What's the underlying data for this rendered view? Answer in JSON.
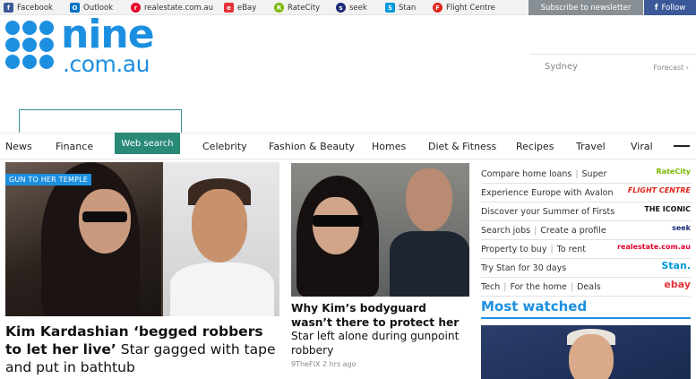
{
  "bookmarks": [
    {
      "label": "Facebook",
      "icon": "facebook-icon",
      "color": "#3b5998",
      "glyph": "f"
    },
    {
      "label": "Outlook",
      "icon": "outlook-icon",
      "color": "#0072c6",
      "glyph": "O"
    },
    {
      "label": "realestate.com.au",
      "icon": "realestate-icon",
      "color": "#e4002b",
      "glyph": "r"
    },
    {
      "label": "eBay",
      "icon": "ebay-icon",
      "color": "#e53238",
      "glyph": "e"
    },
    {
      "label": "RateCity",
      "icon": "ratecity-icon",
      "color": "#7ab800",
      "glyph": "R"
    },
    {
      "label": "seek",
      "icon": "seek-icon",
      "color": "#1c2a76",
      "glyph": "s"
    },
    {
      "label": "Stan",
      "icon": "stan-icon",
      "color": "#0099dd",
      "glyph": "S"
    },
    {
      "label": "Flight Centre",
      "icon": "flight-centre-icon",
      "color": "#e2231a",
      "glyph": "F"
    }
  ],
  "header": {
    "subscribe_label": "Subscribe to newsletter",
    "follow_label": "Follow",
    "logo_nine": "nine",
    "logo_domain": ".com.au",
    "city": "Sydney",
    "forecast_label": "Forecast ›"
  },
  "search": {
    "placeholder": ""
  },
  "nav": {
    "items": [
      "News",
      "Finance",
      "Web search",
      "Celebrity",
      "Fashion & Beauty",
      "Homes",
      "Diet & Fitness",
      "Recipes",
      "Travel",
      "Viral"
    ]
  },
  "lead_story": {
    "tag": "GUN TO HER TEMPLE",
    "headline_bold": "Kim Kardashian ‘begged robbers to let her live’",
    "headline_rest": " Star gagged with tape and put in bathtub"
  },
  "story2": {
    "headline_bold": "Why Kim’s bodyguard wasn’t there to protect her",
    "headline_rest": " Star left alone during gunpoint robbery",
    "meta": "9TheFIX  2 hrs ago"
  },
  "rail": [
    {
      "links": [
        "Compare home loans",
        "Super"
      ],
      "brand": "RateCity",
      "brand_color": "#7ab800"
    },
    {
      "links": [
        "Experience Europe with Avalon"
      ],
      "brand": "FLIGHT CENTRE",
      "brand_color": "#e2231a"
    },
    {
      "links": [
        "Discover your Summer of Firsts"
      ],
      "brand": "THE ICONIC",
      "brand_color": "#111111"
    },
    {
      "links": [
        "Search jobs",
        "Create a profile"
      ],
      "brand": "seek",
      "brand_color": "#1c2a76"
    },
    {
      "links": [
        "Property to buy",
        "To rent"
      ],
      "brand": "realestate.com.au",
      "brand_color": "#e4002b"
    },
    {
      "links": [
        "Try Stan for 30 days"
      ],
      "brand": "Stan.",
      "brand_color": "#0099dd"
    },
    {
      "links": [
        "Tech",
        "For the home",
        "Deals"
      ],
      "brand": "ebay",
      "brand_color": "#e53238"
    }
  ],
  "most_watched": {
    "title": "Most watched"
  }
}
